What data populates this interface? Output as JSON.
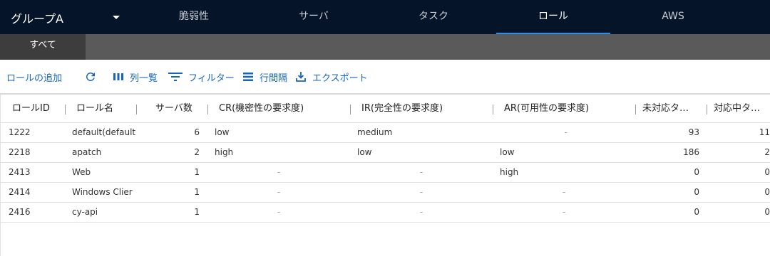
{
  "header": {
    "group_label": "グループA",
    "tabs": [
      {
        "label": "脆弱性",
        "active": false
      },
      {
        "label": "サーバ",
        "active": false
      },
      {
        "label": "タスク",
        "active": false
      },
      {
        "label": "ロール",
        "active": true
      },
      {
        "label": "AWS",
        "active": false
      }
    ]
  },
  "subtabs": [
    {
      "label": "すべて",
      "active": true
    }
  ],
  "toolbar": {
    "add_role": "ロールの追加",
    "refresh_icon": "refresh-icon",
    "columns": "列一覧",
    "filter": "フィルター",
    "row_spacing": "行間隔",
    "export": "エクスポート"
  },
  "table": {
    "headers": [
      "ロールID",
      "ロール名",
      "サーバ数",
      "CR(機密性の要求度)",
      "IR(完全性の要求度)",
      "AR(可用性の要求度)",
      "未対応タ…",
      "対応中タ…"
    ],
    "rows": [
      {
        "id": "1222",
        "name": "default(default",
        "servers": "6",
        "cr": "low",
        "ir": "medium",
        "ar": "-",
        "open": "93",
        "inprogress": "11"
      },
      {
        "id": "2218",
        "name": "apatch",
        "servers": "2",
        "cr": "high",
        "ir": "low",
        "ar": "low",
        "open": "186",
        "inprogress": "2"
      },
      {
        "id": "2413",
        "name": "Web",
        "servers": "1",
        "cr": "-",
        "ir": "-",
        "ar": "high",
        "open": "0",
        "inprogress": "0"
      },
      {
        "id": "2414",
        "name": "Windows Clier",
        "servers": "1",
        "cr": "-",
        "ir": "-",
        "ar": "-",
        "open": "0",
        "inprogress": "0"
      },
      {
        "id": "2416",
        "name": "cy-api",
        "servers": "1",
        "cr": "-",
        "ir": "-",
        "ar": "-",
        "open": "0",
        "inprogress": "0"
      }
    ]
  },
  "colors": {
    "topbar": "#051428",
    "accent": "#1565c0",
    "active_tab_underline": "#2f8fe8",
    "subbar": "#5a5a5a"
  }
}
